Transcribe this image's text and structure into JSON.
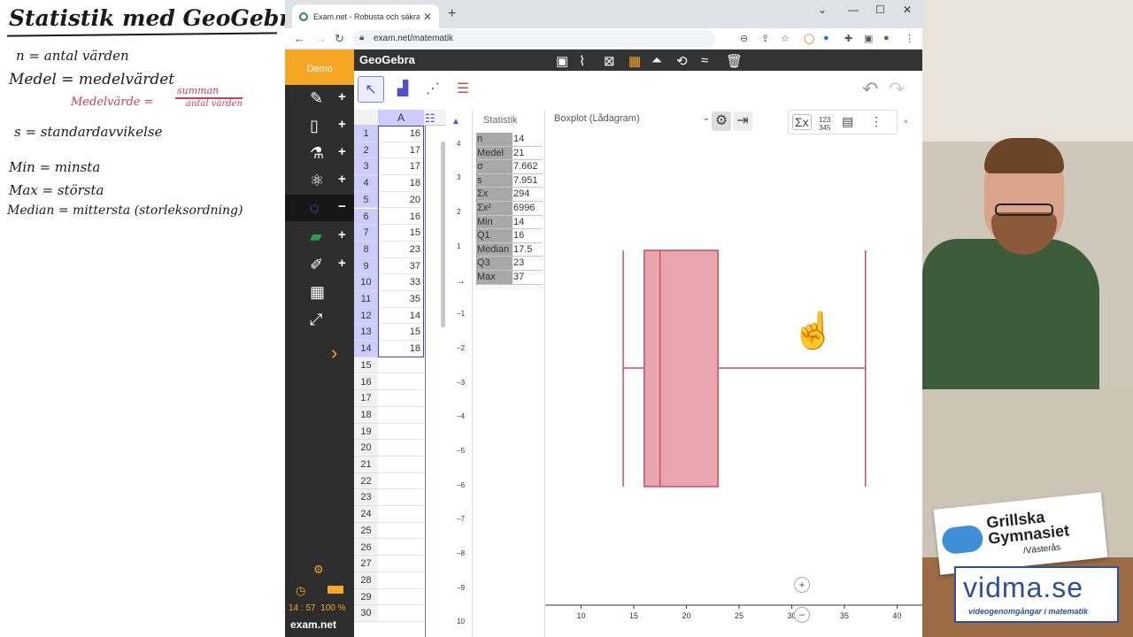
{
  "whiteboard": {
    "title": "Statistik med GeoGebra",
    "lines": [
      "n = antal värden",
      "Medel = medelvärdet",
      "s = standardavvikelse",
      "Min = minsta",
      "Max = största",
      "Median = mittersta (storleksordning)"
    ],
    "formula_lhs": "Medelvärde =",
    "formula_num": "summan",
    "formula_den": "antal värden"
  },
  "browser": {
    "tab_title": "Exam.net - Robusta och säkra di",
    "url": "exam.net/matematik"
  },
  "exam_sidebar": {
    "demo_label": "Demo",
    "time": "14 : 57",
    "battery": "100 %",
    "logo": "exam.net"
  },
  "geogebra": {
    "app_name": "GeoGebra",
    "spreadsheet": {
      "column": "A",
      "rows": [
        {
          "n": "1",
          "v": "16"
        },
        {
          "n": "2",
          "v": "17"
        },
        {
          "n": "3",
          "v": "17"
        },
        {
          "n": "4",
          "v": "18"
        },
        {
          "n": "5",
          "v": "20"
        },
        {
          "n": "6",
          "v": "16"
        },
        {
          "n": "7",
          "v": "15"
        },
        {
          "n": "8",
          "v": "23"
        },
        {
          "n": "9",
          "v": "37"
        },
        {
          "n": "10",
          "v": "33"
        },
        {
          "n": "11",
          "v": "35"
        },
        {
          "n": "12",
          "v": "14"
        },
        {
          "n": "13",
          "v": "15"
        },
        {
          "n": "14",
          "v": "18"
        },
        {
          "n": "15",
          "v": ""
        },
        {
          "n": "16",
          "v": ""
        },
        {
          "n": "17",
          "v": ""
        },
        {
          "n": "18",
          "v": ""
        },
        {
          "n": "19",
          "v": ""
        },
        {
          "n": "20",
          "v": ""
        },
        {
          "n": "21",
          "v": ""
        },
        {
          "n": "22",
          "v": ""
        },
        {
          "n": "23",
          "v": ""
        },
        {
          "n": "24",
          "v": ""
        },
        {
          "n": "25",
          "v": ""
        },
        {
          "n": "26",
          "v": ""
        },
        {
          "n": "27",
          "v": ""
        },
        {
          "n": "28",
          "v": ""
        },
        {
          "n": "29",
          "v": ""
        },
        {
          "n": "30",
          "v": ""
        }
      ]
    },
    "side_axis_ticks": [
      "4",
      "3",
      "2",
      "1",
      "−1",
      "−2",
      "−3",
      "−4",
      "−5",
      "−6",
      "−7",
      "−8",
      "−9",
      "10"
    ],
    "statistics": {
      "title": "Statistik",
      "rows": [
        {
          "k": "n",
          "v": "14"
        },
        {
          "k": "Medel",
          "v": "21"
        },
        {
          "k": "σ",
          "v": "7.662"
        },
        {
          "k": "s",
          "v": "7.951"
        },
        {
          "k": "Σx",
          "v": "294"
        },
        {
          "k": "Σx²",
          "v": "6996"
        },
        {
          "k": "Min",
          "v": "14"
        },
        {
          "k": "Q1",
          "v": "16"
        },
        {
          "k": "Median",
          "v": "17.5"
        },
        {
          "k": "Q3",
          "v": "23"
        },
        {
          "k": "Max",
          "v": "37"
        }
      ]
    },
    "plot_type": "Boxplot (Lådagram)",
    "right_icons": {
      "sum": "Σx",
      "nums": "123 345"
    }
  },
  "chart_data": {
    "type": "boxplot",
    "min": 14,
    "q1": 16,
    "median": 17.5,
    "q3": 23,
    "max": 37,
    "xlim": [
      6.6,
      42.4
    ],
    "x_ticks": [
      10,
      15,
      20,
      25,
      30,
      35,
      40
    ],
    "fill": "#e8a5ad",
    "stroke": "#c8505f",
    "grid": false
  },
  "video": {
    "school_line1": "Grillska",
    "school_line2": "Gymnasiet",
    "school_city": "/Västerås",
    "brand": "vidma.se",
    "brand_sub": "videogenomgångar i matematik"
  }
}
